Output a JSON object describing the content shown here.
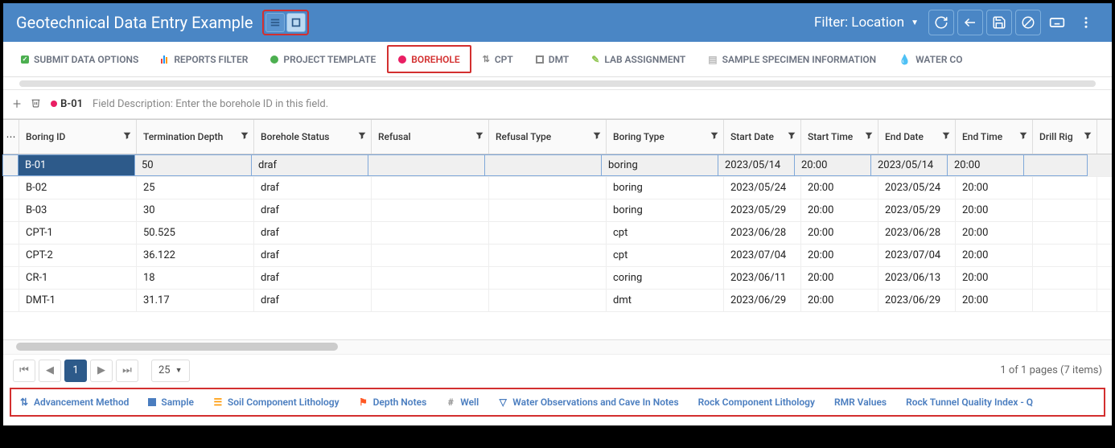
{
  "titlebar": {
    "title": "Geotechnical Data Entry Example",
    "filter_label": "Filter: Location"
  },
  "tabs": [
    {
      "label": "SUBMIT DATA OPTIONS",
      "icon": "check",
      "color": "#4caf50",
      "active": false
    },
    {
      "label": "REPORTS FILTER",
      "icon": "bars",
      "color": "#ff9800",
      "active": false
    },
    {
      "label": "PROJECT TEMPLATE",
      "icon": "dot",
      "color": "#4caf50",
      "active": false
    },
    {
      "label": "BOREHOLE",
      "icon": "dot",
      "color": "#e91e63",
      "active": true
    },
    {
      "label": "CPT",
      "icon": "arrows",
      "color": "#9e9e9e",
      "active": false
    },
    {
      "label": "DMT",
      "icon": "square",
      "color": "#9e9e9e",
      "active": false
    },
    {
      "label": "LAB ASSIGNMENT",
      "icon": "pencil",
      "color": "#8bc34a",
      "active": false
    },
    {
      "label": "SAMPLE SPECIMEN INFORMATION",
      "icon": "doc",
      "color": "#bdbdbd",
      "active": false
    },
    {
      "label": "WATER CO",
      "icon": "drop",
      "color": "#03a9f4",
      "active": false
    }
  ],
  "subtool": {
    "selected_id": "B-01",
    "desc": "Field Description: Enter the borehole ID in this field."
  },
  "columns": [
    "Boring ID",
    "Termination Depth",
    "Borehole Status",
    "Refusal",
    "Refusal Type",
    "Boring Type",
    "Start Date",
    "Start Time",
    "End Date",
    "End Time",
    "Drill Rig"
  ],
  "rows": [
    {
      "sel": true,
      "c": [
        "B-01",
        "50",
        "draf",
        "",
        "",
        "boring",
        "2023/05/14",
        "20:00",
        "2023/05/14",
        "20:00",
        ""
      ]
    },
    {
      "sel": false,
      "c": [
        "B-02",
        "25",
        "draf",
        "",
        "",
        "boring",
        "2023/05/24",
        "20:00",
        "2023/05/24",
        "20:00",
        ""
      ]
    },
    {
      "sel": false,
      "c": [
        "B-03",
        "30",
        "draf",
        "",
        "",
        "boring",
        "2023/05/29",
        "20:00",
        "2023/05/29",
        "20:00",
        ""
      ]
    },
    {
      "sel": false,
      "c": [
        "CPT-1",
        "50.525",
        "draf",
        "",
        "",
        "cpt",
        "2023/06/28",
        "20:00",
        "2023/06/28",
        "20:00",
        ""
      ]
    },
    {
      "sel": false,
      "c": [
        "CPT-2",
        "36.122",
        "draf",
        "",
        "",
        "cpt",
        "2023/07/04",
        "20:00",
        "2023/07/04",
        "20:00",
        ""
      ]
    },
    {
      "sel": false,
      "c": [
        "CR-1",
        "18",
        "draf",
        "",
        "",
        "coring",
        "2023/06/11",
        "20:00",
        "2023/06/13",
        "20:00",
        ""
      ]
    },
    {
      "sel": false,
      "c": [
        "DMT-1",
        "31.17",
        "draf",
        "",
        "",
        "dmt",
        "2023/06/29",
        "20:00",
        "2023/06/29",
        "20:00",
        ""
      ]
    }
  ],
  "pager": {
    "page": "1",
    "page_size": "25",
    "info": "1 of 1 pages (7 items)"
  },
  "bottom_tabs": [
    {
      "label": "Advancement Method",
      "icon": "sort"
    },
    {
      "label": "Sample",
      "icon": "square",
      "color": "#4a7dbf"
    },
    {
      "label": "Soil Component Lithology",
      "icon": "layers",
      "color": "#ff9800"
    },
    {
      "label": "Depth Notes",
      "icon": "flag",
      "color": "#ff5722"
    },
    {
      "label": "Well",
      "icon": "hash"
    },
    {
      "label": "Water Observations and Cave In Notes",
      "icon": "triangle"
    },
    {
      "label": "Rock Component Lithology",
      "icon": ""
    },
    {
      "label": "RMR Values",
      "icon": ""
    },
    {
      "label": "Rock Tunnel Quality Index - Q",
      "icon": ""
    }
  ]
}
